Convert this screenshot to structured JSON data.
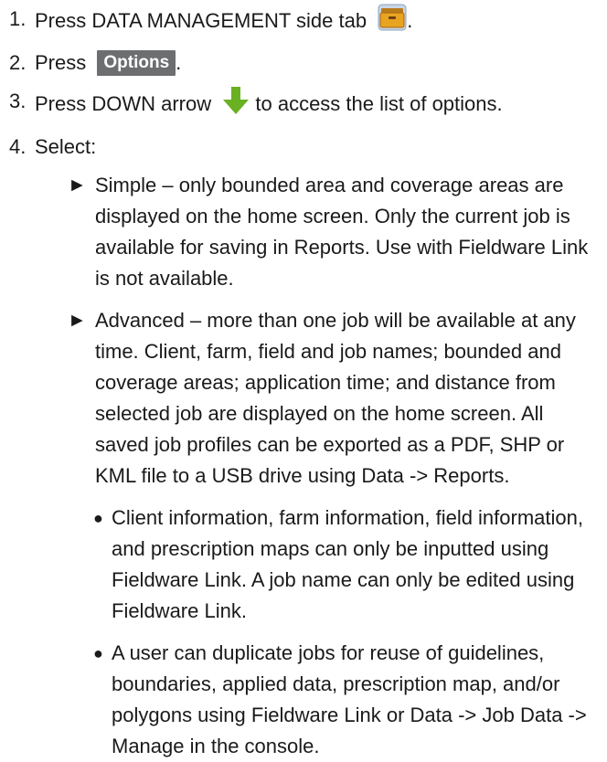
{
  "steps": [
    {
      "num": "1.",
      "pre": "Press DATA MANAGEMENT side tab",
      "post": "."
    },
    {
      "num": "2.",
      "pre": "Press",
      "button": "Options",
      "post": "."
    },
    {
      "num": "3.",
      "pre": "Press DOWN arrow",
      "post": "to access the list of options."
    },
    {
      "num": "4.",
      "pre": "Select:"
    }
  ],
  "options": [
    {
      "symbol": "►",
      "text": "Simple – only bounded area and coverage areas are displayed on the home screen. Only the current job is available for saving in Reports. Use with Fieldware Link is not available."
    },
    {
      "symbol": "►",
      "text": "Advanced – more than one job will be available at any time. Client, farm, field and job names; bounded and coverage areas; application time; and distance from selected job are displayed on the home screen. All saved job profiles can be exported as a PDF, SHP or KML file to a USB drive using Data -> Reports."
    }
  ],
  "bullets": [
    {
      "symbol": "●",
      "text": "Client information, farm information, field information, and prescription maps can only be inputted using Fieldware Link. A job name can only be edited using Fieldware Link."
    },
    {
      "symbol": "●",
      "text": "A user can duplicate jobs for reuse of guidelines, boundaries, applied data, prescription map, and/or polygons using Fieldware Link or Data -> Job Data -> Manage in the console."
    }
  ],
  "icons": {
    "data_management": "data-management-tab-icon",
    "down_arrow": "down-arrow-icon"
  },
  "colors": {
    "button_bg": "#6d6e70",
    "arrow": "#6ab023",
    "folder": "#e8a321"
  }
}
